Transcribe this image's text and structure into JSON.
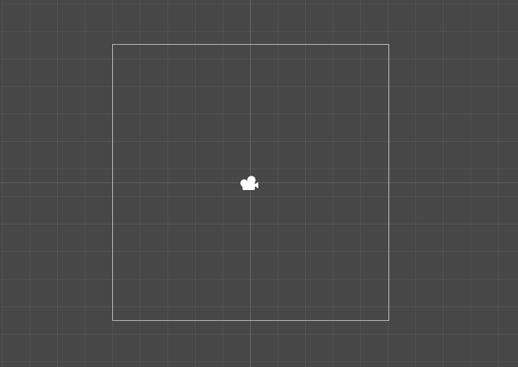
{
  "scene_view": {
    "background_color": "#474747",
    "grid_color": "#545454",
    "frame_color": "#c8c8c8",
    "camera_icon": "video-camera-icon",
    "icon_color": "#ffffff"
  }
}
